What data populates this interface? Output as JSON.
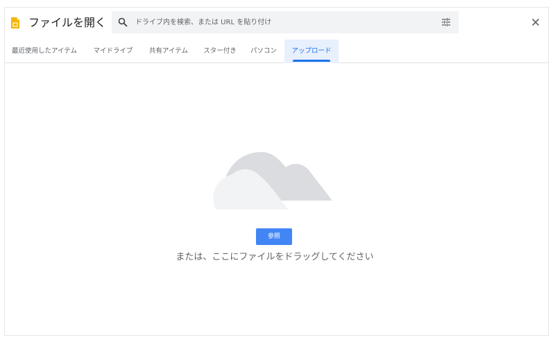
{
  "header": {
    "title": "ファイルを開く",
    "app_icon": "docs-file-icon",
    "close_icon": "close-icon"
  },
  "search": {
    "placeholder": "ドライブ内を検索、または URL を貼り付け",
    "value": "",
    "icon": "search-icon",
    "filter_icon": "tune-icon"
  },
  "tabs": [
    {
      "label": "最近使用したアイテム",
      "active": false
    },
    {
      "label": "マイドライブ",
      "active": false
    },
    {
      "label": "共有アイテム",
      "active": false
    },
    {
      "label": "スター付き",
      "active": false
    },
    {
      "label": "パソコン",
      "active": false
    },
    {
      "label": "アップロード",
      "active": true
    }
  ],
  "upload": {
    "illustration": "cloud-illustration",
    "browse_label": "参照",
    "drop_hint": "または、ここにファイルをドラッグしてください"
  },
  "colors": {
    "accent": "#1a73e8",
    "button": "#4285f4",
    "active_tab_bg": "#e8f0fe",
    "app_icon": "#f4b400"
  }
}
